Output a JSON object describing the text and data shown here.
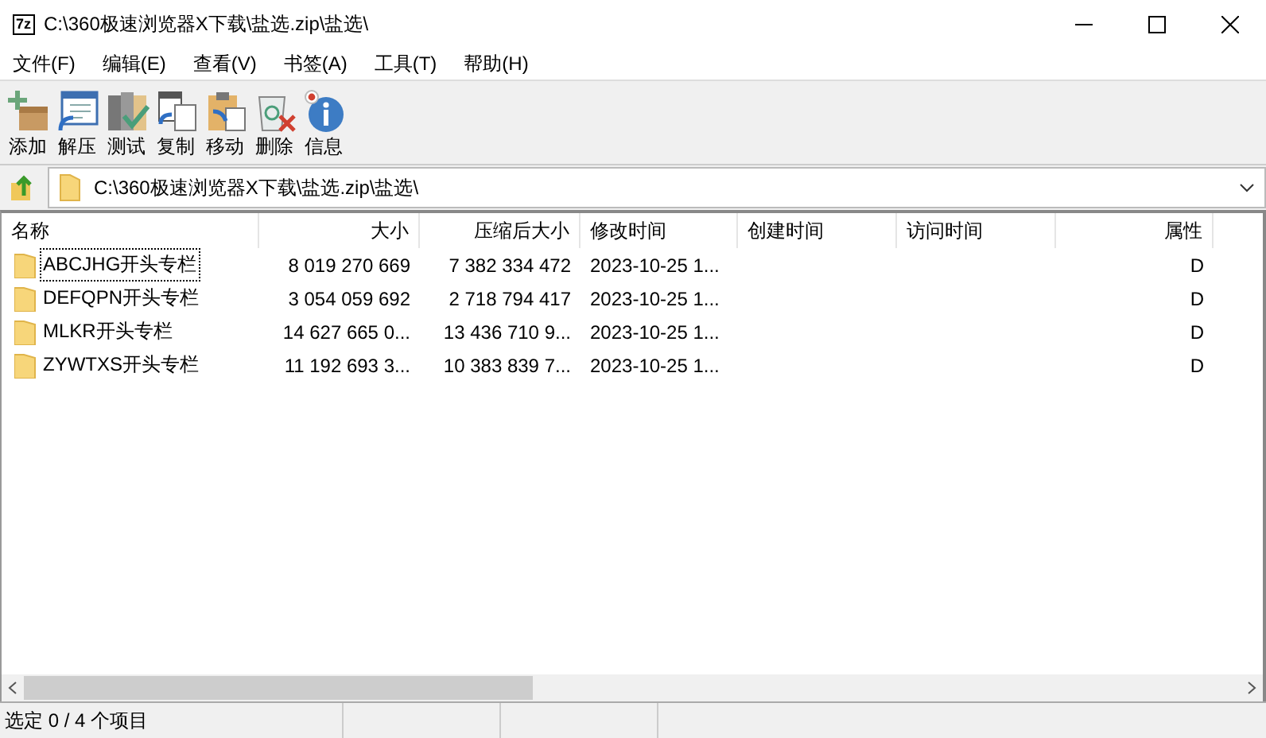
{
  "window": {
    "icon_text": "7z",
    "title": "C:\\360极速浏览器X下载\\盐选.zip\\盐选\\"
  },
  "menu": [
    "文件(F)",
    "编辑(E)",
    "查看(V)",
    "书签(A)",
    "工具(T)",
    "帮助(H)"
  ],
  "toolbar": [
    {
      "kind": "add",
      "label": "添加"
    },
    {
      "kind": "extract",
      "label": "解压"
    },
    {
      "kind": "test",
      "label": "测试"
    },
    {
      "kind": "copy",
      "label": "复制"
    },
    {
      "kind": "move",
      "label": "移动"
    },
    {
      "kind": "delete",
      "label": "删除"
    },
    {
      "kind": "info",
      "label": "信息"
    }
  ],
  "address": {
    "value": "C:\\360极速浏览器X下载\\盐选.zip\\盐选\\"
  },
  "table": {
    "columns": [
      "名称",
      "大小",
      "压缩后大小",
      "修改时间",
      "创建时间",
      "访问时间",
      "属性"
    ],
    "rows": [
      {
        "focused": true,
        "cells": [
          "ABCJHG开头专栏",
          "8 019 270 669",
          "7 382 334 472",
          "2023-10-25 1...",
          "",
          "",
          "D"
        ]
      },
      {
        "focused": false,
        "cells": [
          "DEFQPN开头专栏",
          "3 054 059 692",
          "2 718 794 417",
          "2023-10-25 1...",
          "",
          "",
          "D"
        ]
      },
      {
        "focused": false,
        "cells": [
          "MLKR开头专栏",
          "14 627 665 0...",
          "13 436 710 9...",
          "2023-10-25 1...",
          "",
          "",
          "D"
        ]
      },
      {
        "focused": false,
        "cells": [
          "ZYWTXS开头专栏",
          "11 192 693 3...",
          "10 383 839 7...",
          "2023-10-25 1...",
          "",
          "",
          "D"
        ]
      }
    ]
  },
  "status_bar": [
    "选定 0 / 4 个项目"
  ]
}
